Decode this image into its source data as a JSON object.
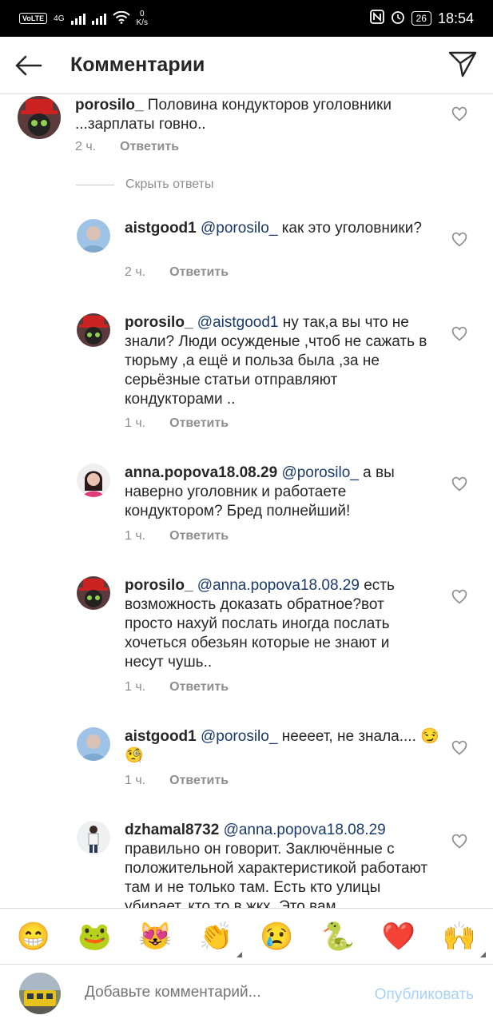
{
  "status_bar": {
    "volte": "VoLTE",
    "net_type": "4G",
    "speed_value": "0",
    "speed_unit": "K/s",
    "battery": "26",
    "time": "18:54"
  },
  "header": {
    "title": "Комментарии",
    "back_icon": "arrow-left-icon",
    "share_icon": "paper-plane-icon"
  },
  "main_comment": {
    "username": "porosilo_",
    "text": "Половина кондукторов уголовники ...зарплаты говно..",
    "time": "2 ч.",
    "reply_label": "Ответить"
  },
  "hide_replies_label": "Скрыть ответы",
  "replies": [
    {
      "username": "aistgood1",
      "mention": "@porosilo_",
      "text": "как это уголовники?",
      "time": "2 ч.",
      "reply_label": "Ответить"
    },
    {
      "username": "porosilo_",
      "mention": "@aistgood1",
      "text": "ну так,а вы что не знали? Люди осужденые ,чтоб не сажать в тюрьму ,а ещё и польза была ,за не серьёзные статьи отправляют кондукторами ..",
      "time": "1 ч.",
      "reply_label": "Ответить"
    },
    {
      "username": "anna.popova18.08.29",
      "mention": "@porosilo_",
      "text": "а вы наверно уголовник и работаете кондуктором? Бред полнейший!",
      "time": "1 ч.",
      "reply_label": "Ответить"
    },
    {
      "username": "porosilo_",
      "mention": "@anna.popova18.08.29",
      "text": "есть возможность доказать обратное?вот просто нахуй послать иногда послать хочеться обезьян которые не знают и несут чушь..",
      "time": "1 ч.",
      "reply_label": "Ответить"
    },
    {
      "username": "aistgood1",
      "mention": "@porosilo_",
      "text": "неееет, не знала.... 😏🧐",
      "time": "1 ч.",
      "reply_label": "Ответить"
    },
    {
      "username": "dzhamal8732",
      "mention": "@anna.popova18.08.29",
      "text": "правильно он говорит. Заключённые с положительной характеристикой работают там и не только там. Есть кто улицы убирает, кто то в жкх. Это вам",
      "time": "",
      "reply_label": ""
    }
  ],
  "emoji_bar": [
    "😁",
    "🐸",
    "😻",
    "👏",
    "😢",
    "🐍",
    "❤️",
    "🙌"
  ],
  "input": {
    "placeholder": "Добавьте комментарий...",
    "publish_label": "Опубликовать"
  },
  "colors": {
    "mention": "#1a3a6b",
    "secondary": "#8e8e8e",
    "publish_disabled": "#a8d2f4"
  }
}
